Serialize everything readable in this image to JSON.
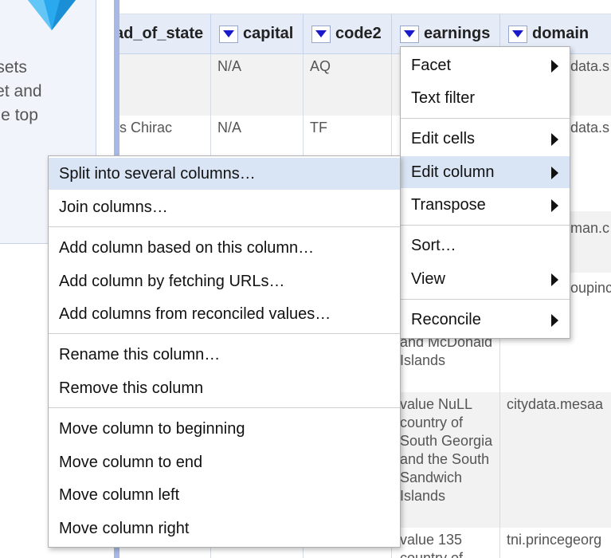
{
  "left_panel": {
    "lines": [
      "ubsets",
      "acet and",
      "t the top"
    ],
    "icon": "diamond-icon"
  },
  "columns": [
    {
      "label": "ad_of_state"
    },
    {
      "label": "capital"
    },
    {
      "label": "code2"
    },
    {
      "label": "earnings"
    },
    {
      "label": "domain"
    }
  ],
  "rows": [
    {
      "head_of_state": "",
      "capital": "N/A",
      "code2": "AQ",
      "earnings": "",
      "domain": "data.s"
    },
    {
      "head_of_state": "s Chirac",
      "capital": "N/A",
      "code2": "TF",
      "earnings": "",
      "domain": "data.s"
    },
    {
      "head_of_state": "",
      "capital": "",
      "code2": "",
      "earnings": "",
      "domain": "man.c"
    },
    {
      "head_of_state": "",
      "capital": "",
      "code2": "",
      "earnings": "and McDonald Islands",
      "domain": "oupinc"
    },
    {
      "head_of_state": "",
      "capital": "",
      "code2": "",
      "earnings": "value NuLL country of South Georgia and the South Sandwich Islands",
      "domain": "citydata.mesaa"
    },
    {
      "head_of_state": "",
      "capital": "",
      "code2": "",
      "earnings": "value 135 country of",
      "domain": "tni.princegeorg"
    }
  ],
  "column_menu": {
    "items": [
      {
        "label": "Facet",
        "submenu": true
      },
      {
        "label": "Text filter",
        "submenu": false
      },
      {
        "label": "Edit cells",
        "submenu": true
      },
      {
        "label": "Edit column",
        "submenu": true
      },
      {
        "label": "Transpose",
        "submenu": true
      },
      {
        "label": "Sort…",
        "submenu": false
      },
      {
        "label": "View",
        "submenu": true
      },
      {
        "label": "Reconcile",
        "submenu": true
      }
    ]
  },
  "edit_column_submenu": {
    "items": [
      "Split into several columns…",
      "Join columns…",
      "Add column based on this column…",
      "Add column by fetching URLs…",
      "Add columns from reconciled values…",
      "Rename this column…",
      "Remove this column",
      "Move column to beginning",
      "Move column to end",
      "Move column left",
      "Move column right"
    ]
  },
  "colors": {
    "header_bg": "#e5ecf8",
    "highlight": "#d9e5f5",
    "dropdown_arrow": "#1a1acc",
    "diamond": "#2aa9ee"
  }
}
